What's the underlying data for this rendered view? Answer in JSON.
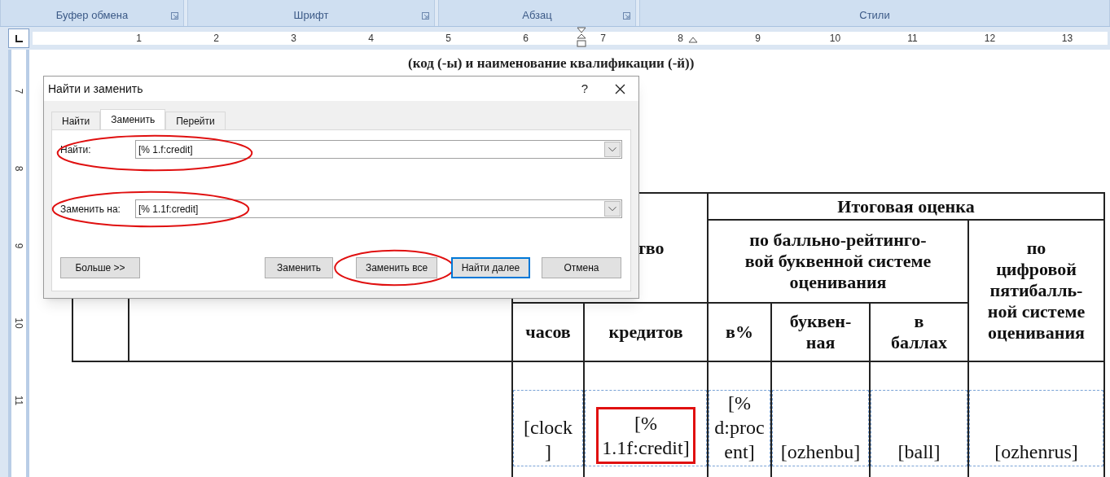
{
  "ribbon": {
    "groups": [
      {
        "label": "Буфер обмена"
      },
      {
        "label": "Шрифт"
      },
      {
        "label": "Абзац"
      },
      {
        "label": "Стили"
      }
    ]
  },
  "ruler": {
    "numbers": [
      "1",
      "2",
      "3",
      "4",
      "5",
      "6",
      "7",
      "8",
      "9",
      "10",
      "11",
      "12",
      "13"
    ]
  },
  "vertical_ruler": {
    "numbers": [
      "7",
      "8",
      "9",
      "10",
      "11"
    ]
  },
  "document": {
    "heading": "(код (-ы) и наименование квалификации (-й))"
  },
  "table": {
    "left_header": "тво",
    "total_header": "Итоговая оценка",
    "rating_header": "по балльно-рейтинго-\nвой буквенной системе\nоценивания",
    "digital_header": "по\nцифровой\nпятибалль-\nной системе\nоценивания",
    "columns": [
      {
        "label": "часов"
      },
      {
        "label": "кредитов"
      },
      {
        "label": "в%"
      },
      {
        "label": "буквен-\nная"
      },
      {
        "label": "в\nбаллах"
      }
    ],
    "cells": [
      {
        "text": "[clock\n]",
        "highlighted": false
      },
      {
        "text": "[%\n1.1f:credit]",
        "highlighted": true
      },
      {
        "text": "[%\nd:proc\nent]",
        "highlighted": false
      },
      {
        "text": "[ozhenbu]",
        "highlighted": false
      },
      {
        "text": "[ball]",
        "highlighted": false
      },
      {
        "text": "[ozhenrus]",
        "highlighted": false
      }
    ]
  },
  "dialog": {
    "title": "Найти и заменить",
    "help": "?",
    "tabs": [
      {
        "label": "Найти",
        "selected": false
      },
      {
        "label": "Заменить",
        "selected": true
      },
      {
        "label": "Перейти",
        "selected": false
      }
    ],
    "fields": [
      {
        "label": "Найти:",
        "value": "[% 1.f:credit]",
        "annotated": true
      },
      {
        "label": "Заменить на:",
        "value": "[% 1.1f:credit]",
        "annotated": true
      }
    ],
    "buttons": [
      {
        "label": "Больше >>",
        "default": false,
        "annotated": false
      },
      {
        "label": "Заменить",
        "default": false,
        "annotated": false
      },
      {
        "label": "Заменить все",
        "default": false,
        "annotated": true
      },
      {
        "label": "Найти далее",
        "default": true,
        "annotated": false
      },
      {
        "label": "Отмена",
        "default": false,
        "annotated": false
      }
    ]
  }
}
